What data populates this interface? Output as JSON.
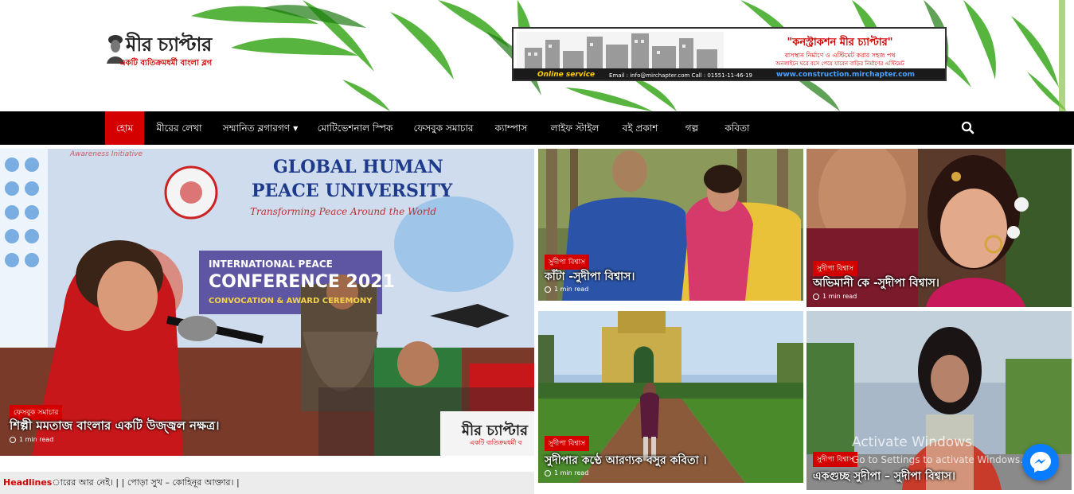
{
  "header": {
    "logo_title": "মীর চ্যাপ্টার",
    "logo_tagline": "একটি ব্যতিক্রমধর্মী বাংলা ব্লগ",
    "banner": {
      "title": "\"কনস্ট্রাকশন মীর চ্যাপ্টার\"",
      "line1": "বাসস্থান নির্মাণে ও এস্টিমেট করার সহজ পথ",
      "line2": "অনলাইনে ঘরে বসে পেয়ে যাবেন বাড়ির নির্মাণের এস্টিমেট",
      "online_label": "Online service",
      "phone": "Email : info@mirchapter.com  Call : 01551-11-46-19",
      "url": "www.construction.mirchapter.com"
    }
  },
  "nav": {
    "items": [
      {
        "label": "হোম",
        "active": true
      },
      {
        "label": "মীরের লেখা"
      },
      {
        "label": "সম্মানিত ব্লগারগণ",
        "has_dropdown": true
      },
      {
        "label": "মোটিভেশনাল স্পিক"
      },
      {
        "label": "ফেসবুক সমাচার"
      },
      {
        "label": "ক্যাম্পাস"
      },
      {
        "label": "লাইফ স্টাইল"
      },
      {
        "label": "বই প্রকাশ"
      },
      {
        "label": "গল্প"
      },
      {
        "label": "কবিতা"
      }
    ],
    "search_icon": "search-icon"
  },
  "posts": {
    "featured": {
      "category": "ফেসবুক সমাচার",
      "title": "শিল্পী মমতাজ বাংলার একটি উজ্জ্বল নক্ষত্র।",
      "read_time": "1 min read",
      "image_text": {
        "line1": "GLOBAL HUMAN",
        "line2": "PEACE UNIVERSITY",
        "line3": "Transforming Peace Around the World",
        "line4": "INTERNATIONAL PEACE",
        "line5": "CONFERENCE 2021",
        "line6": "CONVOCATION & AWARD CEREMONY",
        "top_caption": "Awareness Initiative",
        "logo_title": "মীর চ্যাপ্টার",
        "logo_tagline": "একটি ব্যতিক্রমধর্মী ব"
      }
    },
    "grid": [
      {
        "category": "সুদীপা বিশ্বাস",
        "title": "কাঁটা -সুদীপা বিশ্বাস।",
        "read_time": "1 min read"
      },
      {
        "category": "সুদীপা বিশ্বাস",
        "title": "অভিমানী কে -সুদীপা বিশ্বাস।",
        "read_time": "1 min read"
      },
      {
        "category": "সুদীপা বিশ্বাস",
        "title": "সুদীপার কণ্ঠে আরণ্যক বসুর কবিতা ।",
        "read_time": "1 min read"
      },
      {
        "category": "সুদীপা বিশ্বাস",
        "title": "একগুচ্ছ সুদীপা – সুদীপা বিশ্বাস।"
      }
    ]
  },
  "headlines": {
    "label": "Headlines",
    "text": "ারের আর নেই। | | পোড়া সুখ – কোহিনূর আক্তার। |"
  },
  "overlay": {
    "activate_title": "Activate Windows",
    "activate_sub": "Go to Settings to activate Windows."
  },
  "colors": {
    "accent": "#d40000",
    "nav_bg": "#000000",
    "messenger": "#0a7cff"
  }
}
